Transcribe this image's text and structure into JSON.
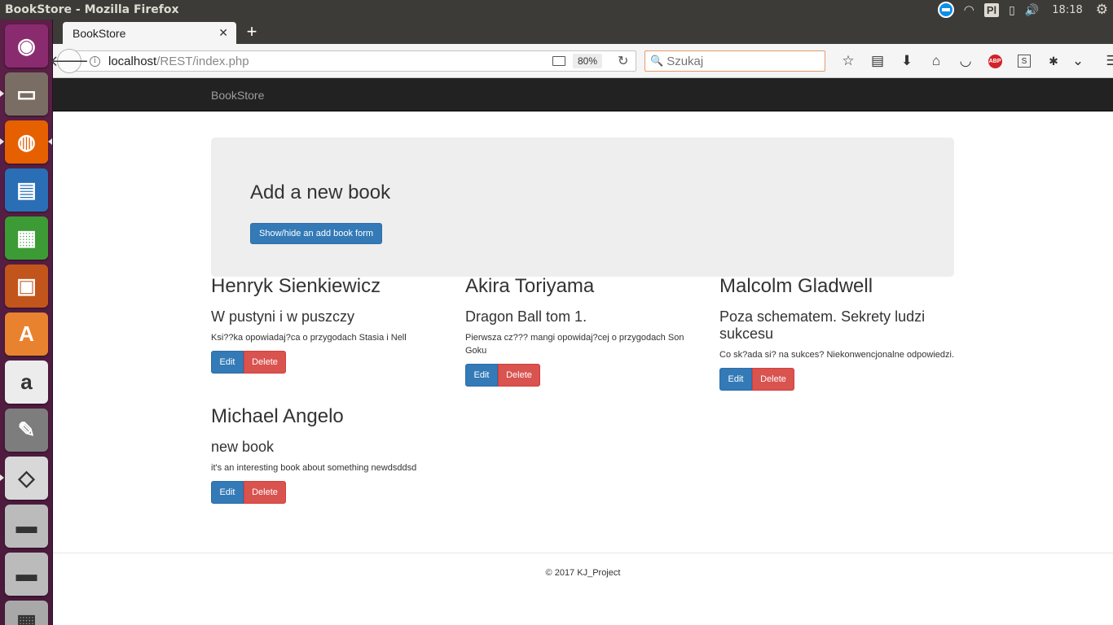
{
  "window": {
    "title": "BookStore - Mozilla Firefox"
  },
  "panel": {
    "clock": "18:18",
    "keyboard_layout": "Pl"
  },
  "launcher": {
    "items": [
      {
        "name": "ubuntu-dash",
        "color": "#8a2b6f"
      },
      {
        "name": "files",
        "color": "#7a6e64"
      },
      {
        "name": "firefox",
        "color": "#e66000"
      },
      {
        "name": "libreoffice-writer",
        "color": "#2a6fb5"
      },
      {
        "name": "libreoffice-calc",
        "color": "#3d9b35"
      },
      {
        "name": "libreoffice-impress",
        "color": "#c2551b"
      },
      {
        "name": "ubuntu-software",
        "color": "#e9822f"
      },
      {
        "name": "amazon",
        "color": "#ececec"
      },
      {
        "name": "system-settings",
        "color": "#7d7d7d"
      },
      {
        "name": "document-viewer",
        "color": "#d8d8d8"
      },
      {
        "name": "drive-1",
        "color": "#bbbbbb"
      },
      {
        "name": "drive-2",
        "color": "#bbbbbb"
      },
      {
        "name": "trash",
        "color": "#a8a8a8"
      }
    ]
  },
  "browser": {
    "tab_title": "BookStore",
    "new_tab": "+",
    "url_host": "localhost",
    "url_path": "/REST/index.php",
    "zoom": "80%",
    "search_placeholder": "Szukaj"
  },
  "site": {
    "brand": "BookStore",
    "jumbotron_title": "Add a new book",
    "toggle_form_label": "Show/hide an add book form",
    "edit_label": "Edit",
    "delete_label": "Delete",
    "footer": "© 2017 KJ_Project",
    "books": [
      {
        "author": "Henryk Sienkiewicz",
        "title": "W pustyni i w puszczy",
        "description": "Ksi??ka opowiadaj?ca o przygodach Stasia i Nell"
      },
      {
        "author": "Akira Toriyama",
        "title": "Dragon Ball tom 1.",
        "description": "Pierwsza cz??? mangi opowidaj?cej o przygodach Son Goku"
      },
      {
        "author": "Malcolm Gladwell",
        "title": "Poza schematem. Sekrety ludzi sukcesu",
        "description": "Co sk?ada si? na sukces? Niekonwencjonalne odpowiedzi."
      },
      {
        "author": "Michael Angelo",
        "title": "new book",
        "description": "it's an interesting book about something newdsddsd"
      }
    ]
  }
}
